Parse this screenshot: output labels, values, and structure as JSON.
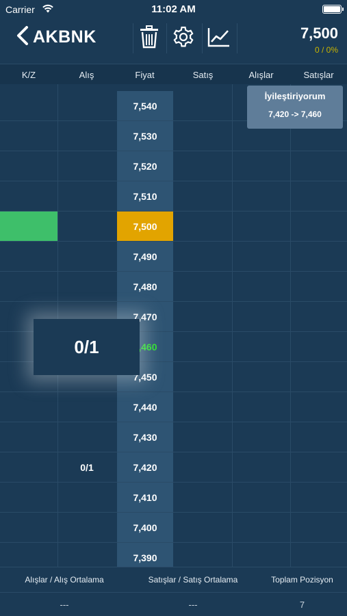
{
  "status_bar": {
    "carrier": "Carrier",
    "time": "11:02 AM"
  },
  "header": {
    "symbol": "AKBNK",
    "last_price": "7,500",
    "change": "0 / 0%",
    "icons": [
      "chevron-left-icon",
      "trash-icon",
      "gear-icon",
      "chart-icon"
    ]
  },
  "columns": [
    "K/Z",
    "Alış",
    "Fiyat",
    "Satış",
    "Alışlar",
    "Satışlar"
  ],
  "ladder": [
    {
      "price": "7,540",
      "bid": "",
      "pl": ""
    },
    {
      "price": "7,530",
      "bid": "",
      "pl": ""
    },
    {
      "price": "7,520",
      "bid": "",
      "pl": ""
    },
    {
      "price": "7,510",
      "bid": "",
      "pl": ""
    },
    {
      "price": "7,500",
      "bid": "",
      "pl": "",
      "current": true,
      "pl_positive": true
    },
    {
      "price": "7,490",
      "bid": "",
      "pl": ""
    },
    {
      "price": "7,480",
      "bid": "",
      "pl": ""
    },
    {
      "price": "7,470",
      "bid": "",
      "pl": ""
    },
    {
      "price": "7,460",
      "bid": "",
      "pl": "",
      "highlight": true
    },
    {
      "price": "7,450",
      "bid": "",
      "pl": ""
    },
    {
      "price": "7,440",
      "bid": "",
      "pl": ""
    },
    {
      "price": "7,430",
      "bid": "",
      "pl": ""
    },
    {
      "price": "7,420",
      "bid": "0/1",
      "pl": ""
    },
    {
      "price": "7,410",
      "bid": "",
      "pl": ""
    },
    {
      "price": "7,400",
      "bid": "",
      "pl": ""
    },
    {
      "price": "7,390",
      "bid": "",
      "pl": ""
    }
  ],
  "improve_tooltip": {
    "title": "İyileştiriyorum",
    "range": "7,420 -> 7,460"
  },
  "popup": {
    "quantity": "0/1"
  },
  "footer": {
    "labels": [
      "Alışlar / Alış Ortalama",
      "Satışlar / Satış Ortalama",
      "Toplam Pozisyon"
    ],
    "values": [
      "---",
      "---",
      "7"
    ]
  },
  "colors": {
    "background": "#1b3a55",
    "current_price": "#e2a400",
    "profit": "#3ebf6a",
    "highlight_text": "#2de02d",
    "change_text": "#c9b400"
  }
}
